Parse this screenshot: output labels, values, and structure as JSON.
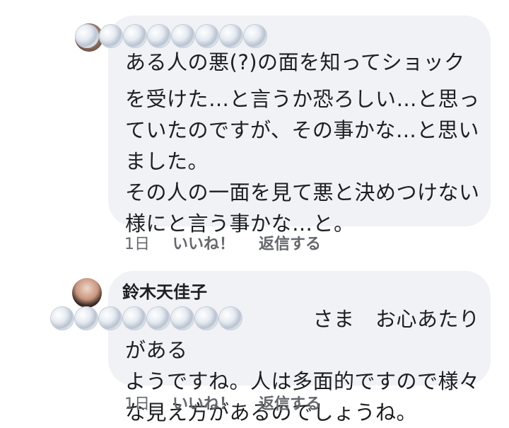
{
  "comments": [
    {
      "author": "",
      "text_lines": [
        "ある人の悪(?)の面を知ってショック",
        "を受けた…と言うか恐ろしい…と思っ\nていたのですが、その事かな…と思い\nました。\nその人の一面を見て悪と決めつけない\n様にと言う事かな…と。"
      ],
      "time": "1日",
      "like_label": "いいね！",
      "reply_label": "返信する"
    },
    {
      "author": "鈴木天佳子",
      "text_lines": [
        "　　　　　　　　　さま　お心あたりがある\nようですね。人は多面的ですので様々\nな見え方があるのでしょうね。"
      ],
      "time": "1日",
      "like_label": "いいね！",
      "reply_label": "返信する"
    }
  ]
}
